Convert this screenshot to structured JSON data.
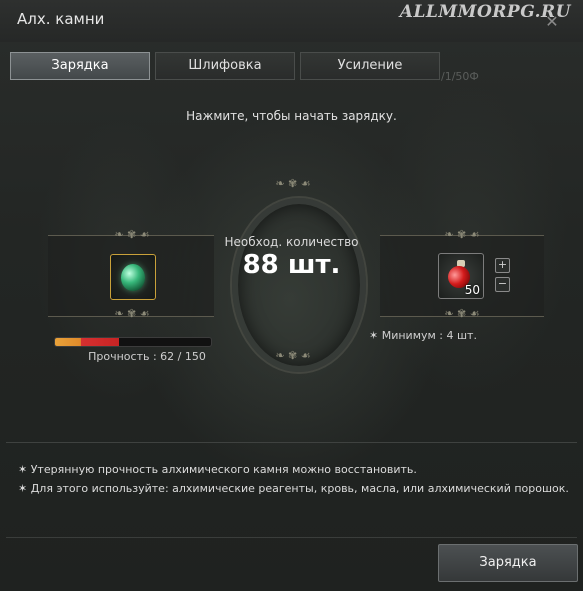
{
  "window": {
    "title": "Алх. камни",
    "watermark": "ALLMMORPG.RU",
    "close_icon": "✕"
  },
  "tabs": [
    {
      "label": "Зарядка",
      "active": true
    },
    {
      "label": "Шлифовка",
      "active": false
    },
    {
      "label": "Усиление",
      "active": false
    }
  ],
  "tab_extra": "/1/50Ф",
  "hint": "Нажмите, чтобы начать зарядку.",
  "required": {
    "label": "Необход. количество",
    "count": "88 шт."
  },
  "stone": {
    "icon": "alchemy-stone-icon",
    "durability_text": "Прочность : 62 / 150",
    "durability_fraction": 0.41
  },
  "material": {
    "icon": "potion-icon",
    "count": "50",
    "plus": "+",
    "minus": "−",
    "minimum": "✶ Минимум : 4 шт."
  },
  "notes": [
    "✶ Утерянную прочность алхимического камня можно восстановить.",
    "✶ Для этого используйте: алхимические реагенты, кровь, масла, или алхимический порошок."
  ],
  "action_button": "Зарядка",
  "ornament": "❧ ✾ ☙",
  "colors": {
    "accent_gold": "#c9a13a",
    "active_tab": "#5a5f61",
    "bar_orange": "#e8a23a",
    "bar_red": "#d63030"
  }
}
